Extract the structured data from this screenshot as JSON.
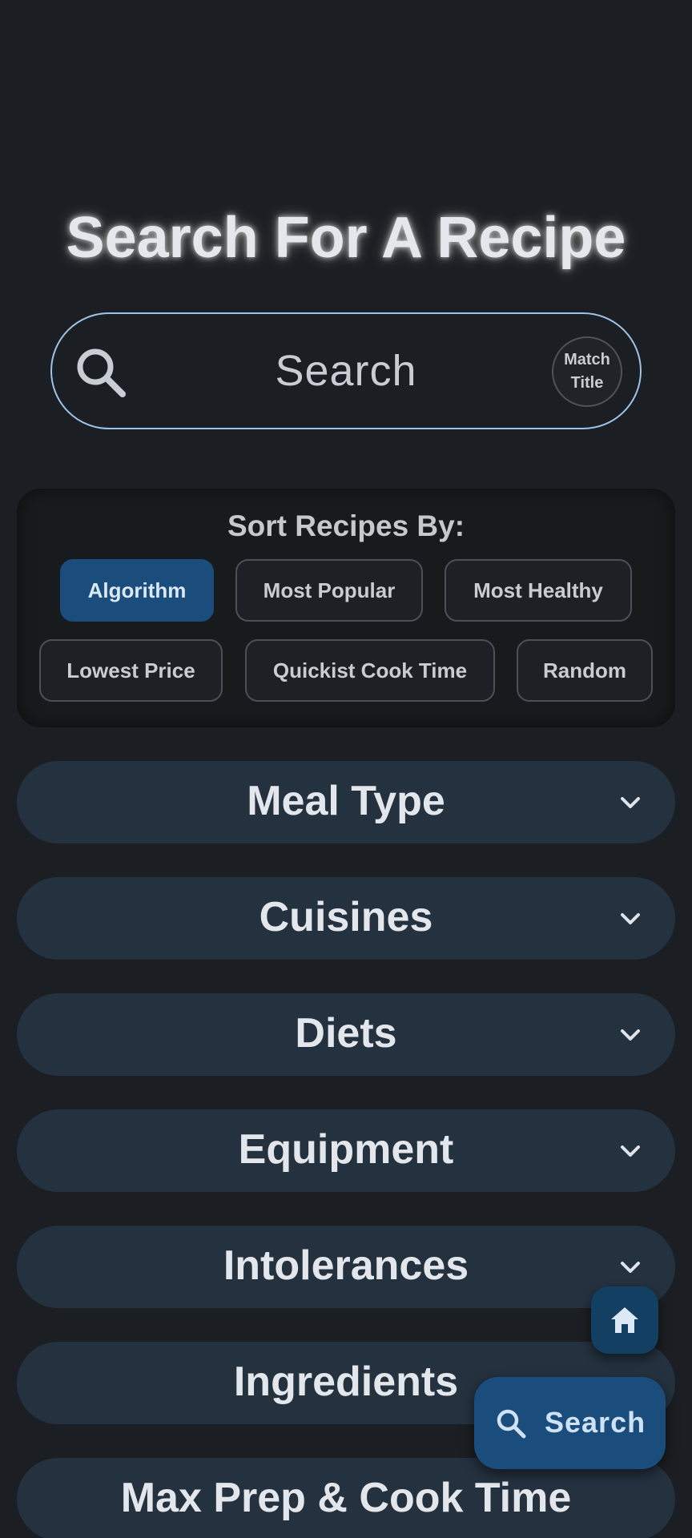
{
  "page": {
    "title": "Search For A Recipe"
  },
  "search": {
    "placeholder": "Search",
    "match_line1": "Match",
    "match_line2": "Title"
  },
  "sort": {
    "title": "Sort Recipes By:",
    "options": [
      "Algorithm",
      "Most Popular",
      "Most Healthy",
      "Lowest Price",
      "Quickist Cook Time",
      "Random"
    ],
    "selected": "Algorithm"
  },
  "filters": [
    "Meal Type",
    "Cuisines",
    "Diets",
    "Equipment",
    "Intolerances",
    "Ingredients",
    "Max Prep & Cook Time"
  ],
  "fab": {
    "search_label": "Search",
    "home_icon": "home-icon",
    "search_icon": "search-icon"
  },
  "colors": {
    "accent": "#1a4c7c",
    "outline": "#9fc3e8",
    "panel": "#24313f",
    "background": "#1b1e22"
  }
}
